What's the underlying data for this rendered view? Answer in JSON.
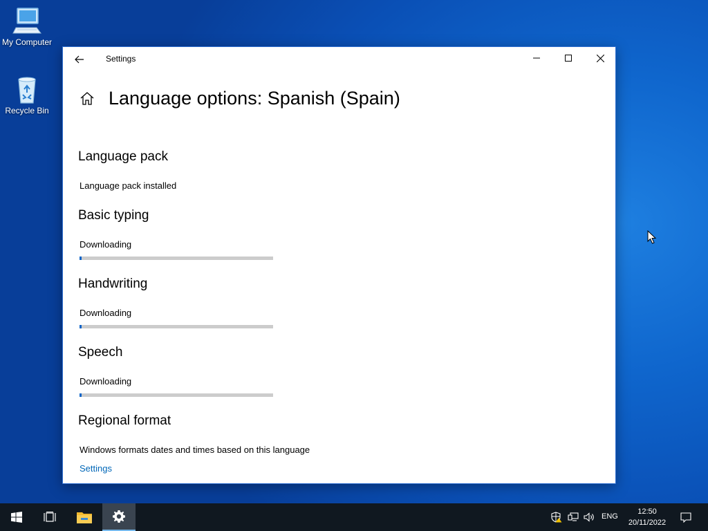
{
  "desktop": {
    "icons": [
      {
        "label": "My Computer",
        "icon": "computer-icon"
      },
      {
        "label": "Recycle Bin",
        "icon": "recycle-bin-icon"
      }
    ]
  },
  "window": {
    "title": "Settings",
    "page_title": "Language options: Spanish (Spain)",
    "sections": [
      {
        "title": "Language pack",
        "status": "Language pack installed"
      },
      {
        "title": "Basic typing",
        "status": "Downloading",
        "progress": 0.01
      },
      {
        "title": "Handwriting",
        "status": "Downloading",
        "progress": 0.01
      },
      {
        "title": "Speech",
        "status": "Downloading",
        "progress": 0.01
      },
      {
        "title": "Regional format",
        "status": "Windows formats dates and times based on this language",
        "link": "Settings"
      }
    ]
  },
  "taskbar": {
    "items": [
      "start-icon",
      "task-view-icon",
      "file-explorer-icon",
      "settings-gear-icon"
    ],
    "tray": {
      "language": "ENG",
      "time": "12:50",
      "date": "20/11/2022"
    }
  },
  "colors": {
    "accent": "#0a64c8",
    "link": "#0067b8",
    "taskbar": "#101820",
    "desktop": "#0f66cd"
  }
}
